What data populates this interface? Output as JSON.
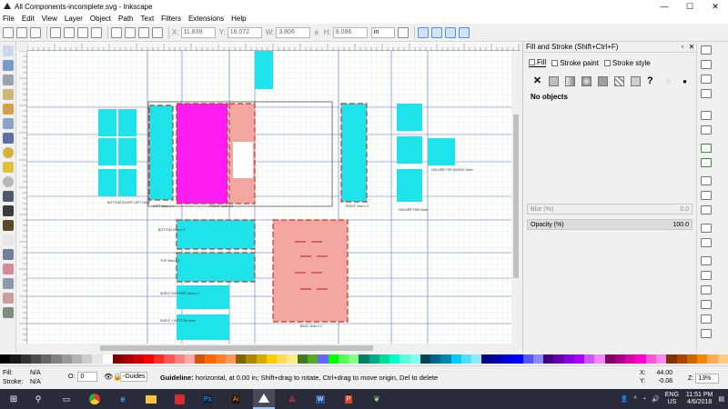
{
  "window": {
    "title": "All Components-incomplete.svg - Inkscape",
    "min": "—",
    "max": "☐",
    "close": "✕"
  },
  "menu": [
    "File",
    "Edit",
    "View",
    "Layer",
    "Object",
    "Path",
    "Text",
    "Filters",
    "Extensions",
    "Help"
  ],
  "toolbar": {
    "x_label": "X:",
    "x_value": "11.839",
    "y_label": "Y:",
    "y_value": "16.072",
    "w_label": "W:",
    "w_value": "3.806",
    "lock": "a",
    "h_label": "H:",
    "h_value": "8.086",
    "unit": "in"
  },
  "canvas_labels": [
    "BOTTOM SHORT LEFT HALF",
    "LEFT 3mm x 2",
    "FRONT 3mm x 2",
    "RIGHT 3mm x 2",
    "HOLDER FOR SINGLE 3mm",
    "HOLDER THIN 3mm",
    "BOTTOM 3mm x 2",
    "TOP 3mm x 2",
    "BACK 3mm x 2",
    "SHELF SUPPORT 3mm x 2",
    "SHELF + BOTTOM 3mm"
  ],
  "panel": {
    "title": "Fill and Stroke (Shift+Ctrl+F)",
    "tabs": [
      "Fill",
      "Stroke paint",
      "Stroke style"
    ],
    "no_objects": "No objects",
    "blur_label": "Blur (%)",
    "blur_value": "0.0",
    "opacity_label": "Opacity (%)",
    "opacity_value": "100.0"
  },
  "status": {
    "fill_label": "Fill:",
    "fill_value": "N/A",
    "stroke_label": "Stroke:",
    "stroke_value": "N/A",
    "o_label": "O:",
    "o_value": "0",
    "layer": "-Guides",
    "message_bold": "Guideline:",
    "message": " horizontal, at 0.00 in; Shift+drag to rotate, Ctrl+drag to move origin, Del to delete",
    "x_label": "X:",
    "x_value": "44.00",
    "y_label": "Y:",
    "y_value": "-0.08",
    "z_label": "Z:",
    "zoom": "13%"
  },
  "tray": {
    "lang1": "ENG",
    "lang2": "US",
    "time": "11:51 PM",
    "date": "4/6/2018"
  }
}
